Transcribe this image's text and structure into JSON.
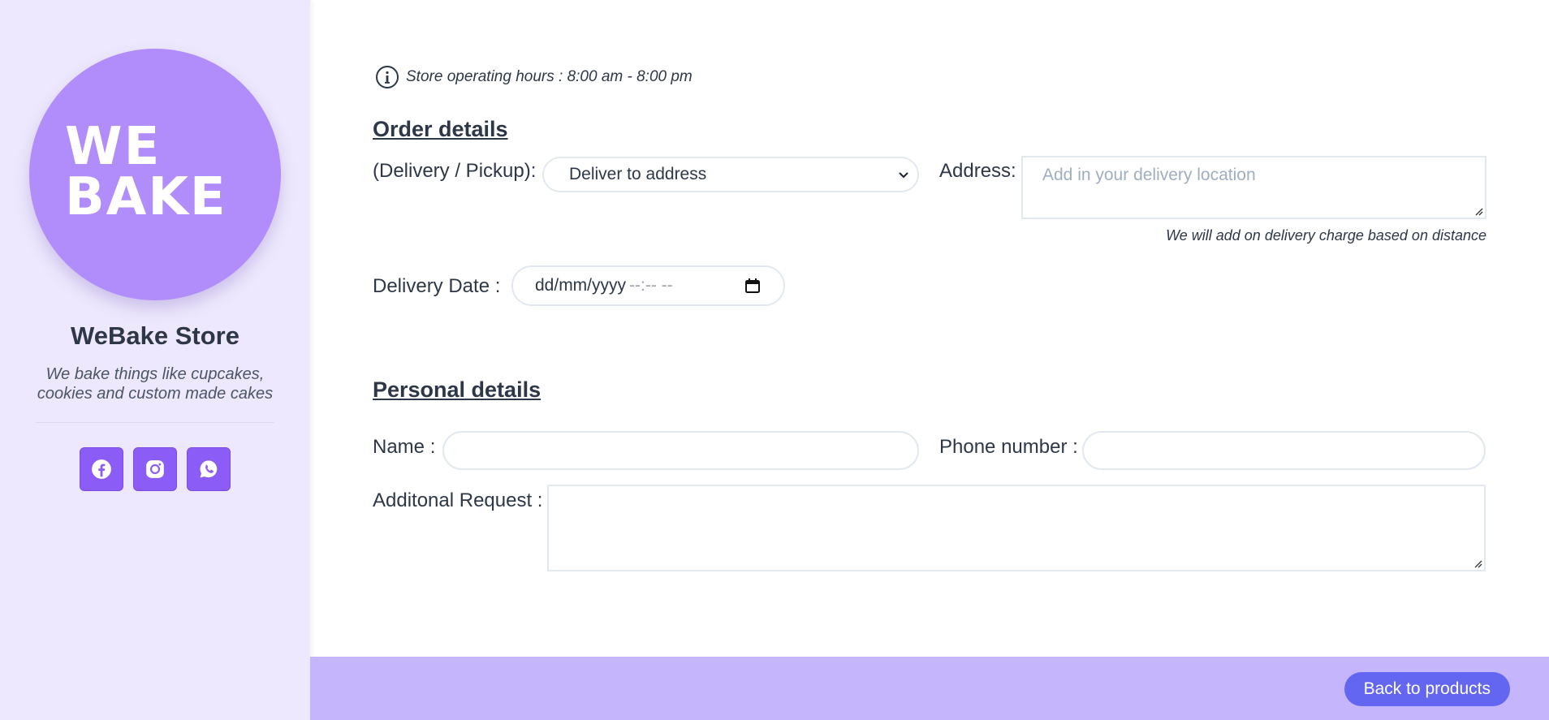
{
  "sidebar": {
    "logo": {
      "line1": "WE",
      "line2": "BAKE"
    },
    "store_name": "WeBake Store",
    "tagline": "We bake things like cupcakes, cookies and custom made cakes",
    "socials": [
      {
        "icon": "facebook-icon"
      },
      {
        "icon": "instagram-icon"
      },
      {
        "icon": "whatsapp-icon"
      }
    ]
  },
  "main": {
    "info": {
      "icon": "info-icon",
      "text": "Store operating hours : 8:00 am - 8:00 pm"
    },
    "order_details": {
      "title": "Order details",
      "delivery_label": "(Delivery / Pickup):",
      "delivery_value": "Deliver to address",
      "address_label": "Address:",
      "address_placeholder": "Add in your delivery location",
      "delivery_hint": "We will add on delivery charge based on distance",
      "date_label": "Delivery Date :",
      "date_mask": "dd/mm/yyyy",
      "time_mask": "--:-- --"
    },
    "personal_details": {
      "title": "Personal details",
      "name_label": "Name :",
      "name_value": "",
      "phone_label": "Phone number :",
      "phone_value": "",
      "request_label": "Additonal Request :",
      "request_value": ""
    }
  },
  "footer": {
    "back_label": "Back to products"
  },
  "colors": {
    "sidebar_bg": "#ede8fd",
    "logo_bg": "#b18cfb",
    "social_bg": "#8b5cf6",
    "footer_bg": "#c4b5fd",
    "button_bg": "#6366f1"
  }
}
